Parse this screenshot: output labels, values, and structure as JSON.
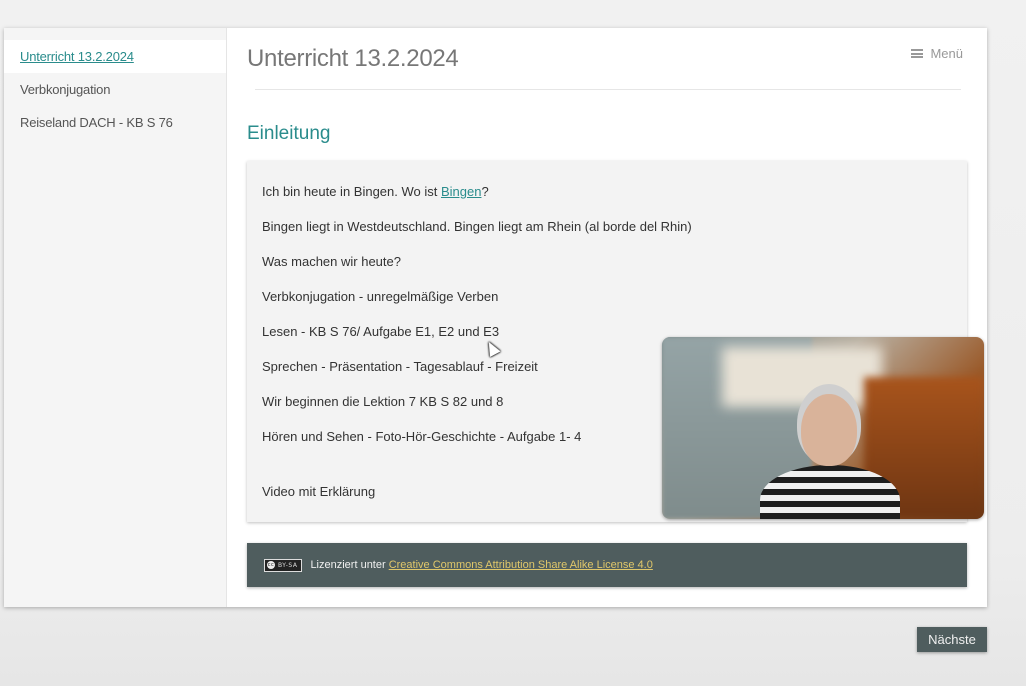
{
  "sidebar": {
    "items": [
      {
        "label": "Unterricht 13.2.2024"
      },
      {
        "label": "Verbkonjugation"
      },
      {
        "label": "Reiseland DACH - KB S 76"
      }
    ]
  },
  "header": {
    "title": "Unterricht 13.2.2024",
    "menu_label": "Menü",
    "menu_icon": "hamburger-icon"
  },
  "section": {
    "heading": "Einleitung"
  },
  "content": {
    "line1_prefix": "Ich bin heute in Bingen. Wo ist ",
    "line1_link": "Bingen",
    "line1_suffix": "?",
    "line2": "Bingen liegt in Westdeutschland. Bingen liegt am Rhein (al borde del Rhin)",
    "line3": "Was machen wir heute?",
    "line4": "Verbkonjugation - unregelmäßige Verben",
    "line5": "Lesen - KB S 76/ Aufgabe E1, E2 und E3",
    "line6": "Sprechen - Präsentation - Tagesablauf - Freizeit",
    "line7": "Wir beginnen die Lektion 7 KB S 82 und  8",
    "line8": "Hören und Sehen - Foto-Hör-Geschichte - Aufgabe 1- 4",
    "line9": "Video mit Erklärung"
  },
  "footer": {
    "badge_cc": "cc",
    "badge_text": "BY-SA",
    "license_prefix": "Lizenziert unter ",
    "license_link": "Creative Commons Attribution Share Alike License 4.0"
  },
  "navigation": {
    "next_label": "Nächste"
  },
  "colors": {
    "accent": "#2a8c8c",
    "footer_bg": "#4f5d5e",
    "link_footer": "#e0c76a"
  }
}
